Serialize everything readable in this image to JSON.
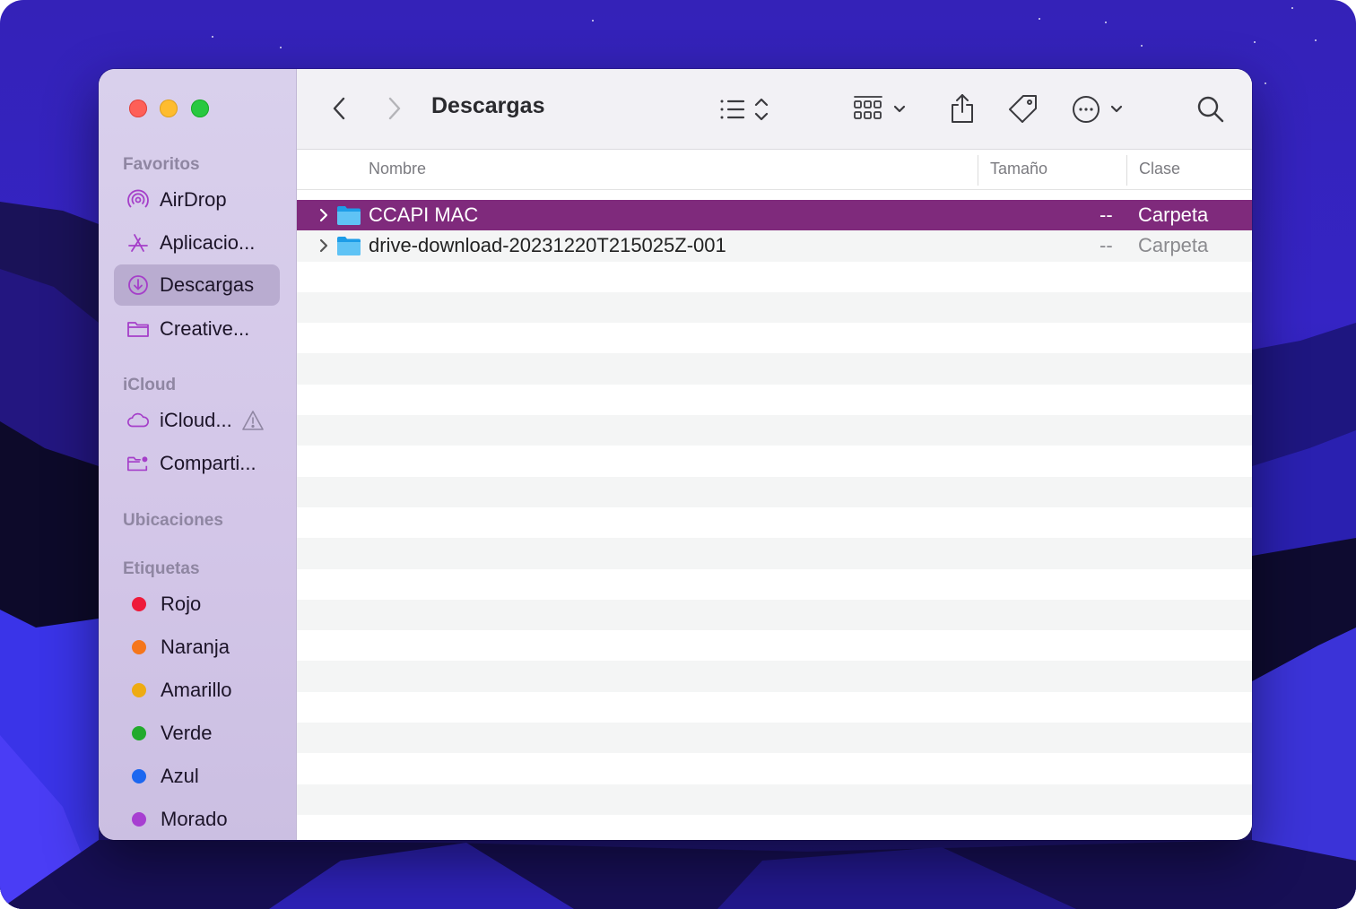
{
  "colors": {
    "selection": "#7f2a7c",
    "sidebar_selected": "#b9acd0",
    "tag_red": "#ee1a3a",
    "tag_orange": "#f5761b",
    "tag_yellow": "#eeab12",
    "tag_green": "#22aa2c",
    "tag_blue": "#1c67f0",
    "tag_purple": "#a73fd1"
  },
  "window": {
    "title": "Descargas",
    "traffic_lights": [
      "close",
      "minimize",
      "zoom"
    ]
  },
  "toolbar": {
    "icons": [
      "back-icon",
      "forward-icon",
      "list-view-icon",
      "group-icon",
      "share-icon",
      "tag-icon",
      "more-icon",
      "search-icon"
    ]
  },
  "sidebar": {
    "favorites": {
      "heading": "Favoritos",
      "items": [
        {
          "label": "AirDrop",
          "icon": "airdrop-icon"
        },
        {
          "label": "Aplicacio...",
          "icon": "applications-icon"
        },
        {
          "label": "Descargas",
          "icon": "downloads-icon",
          "selected": true
        },
        {
          "label": "Creative...",
          "icon": "folder-icon"
        }
      ]
    },
    "icloud": {
      "heading": "iCloud",
      "items": [
        {
          "label": "iCloud...",
          "icon": "icloud-icon",
          "badge": "warning-icon"
        },
        {
          "label": "Comparti...",
          "icon": "shared-folder-icon"
        }
      ]
    },
    "locations": {
      "heading": "Ubicaciones"
    },
    "tags": {
      "heading": "Etiquetas",
      "items": [
        {
          "label": "Rojo"
        },
        {
          "label": "Naranja"
        },
        {
          "label": "Amarillo"
        },
        {
          "label": "Verde"
        },
        {
          "label": "Azul"
        },
        {
          "label": "Morado"
        }
      ]
    }
  },
  "columns": {
    "name": "Nombre",
    "size": "Tamaño",
    "kind": "Clase"
  },
  "files": [
    {
      "name": "CCAPI MAC",
      "size": "--",
      "kind": "Carpeta",
      "selected": true
    },
    {
      "name": "drive-download-20231220T215025Z-001",
      "size": "--",
      "kind": "Carpeta",
      "selected": false
    }
  ]
}
